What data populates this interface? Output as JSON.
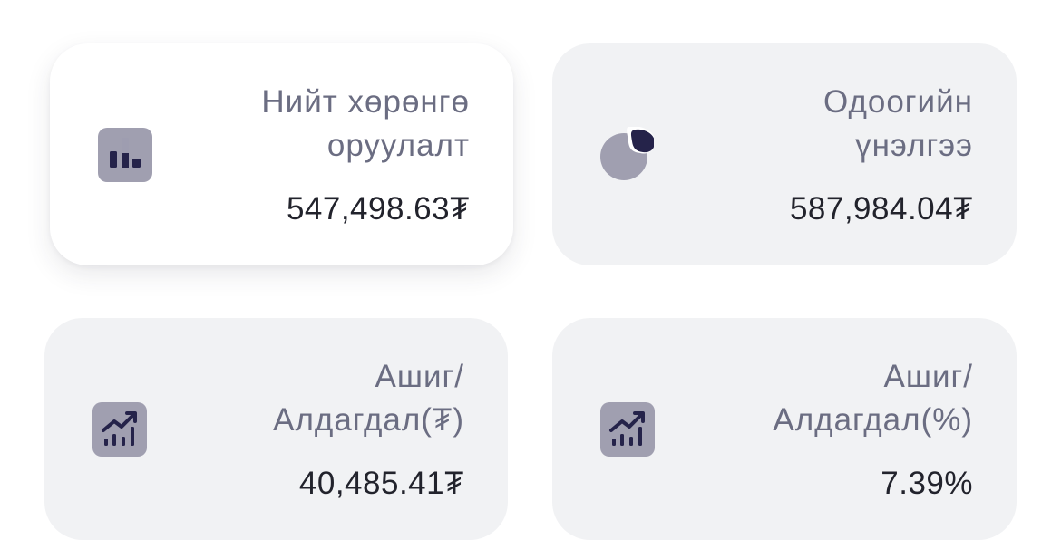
{
  "cards": [
    {
      "label": "Нийт хөрөнгө\nоруулалт",
      "value": "547,498.63₮",
      "icon": "bar-chart-icon",
      "selected": true
    },
    {
      "label": "Одоогийн\nүнэлгээ",
      "value": "587,984.04₮",
      "icon": "pie-chart-icon",
      "selected": false
    },
    {
      "label": "Ашиг/\nАлдагдал(₮)",
      "value": "40,485.41₮",
      "icon": "trending-up-icon",
      "selected": false
    },
    {
      "label": "Ашиг/\nАлдагдал(%)",
      "value": "7.39%",
      "icon": "trending-up-icon",
      "selected": false
    }
  ],
  "colors": {
    "card_background": "#f1f2f4",
    "card_selected_background": "#ffffff",
    "icon_background": "#a09fb0",
    "icon_foreground": "#25234a",
    "label_text": "#6b6d82",
    "value_text": "#22232c"
  }
}
